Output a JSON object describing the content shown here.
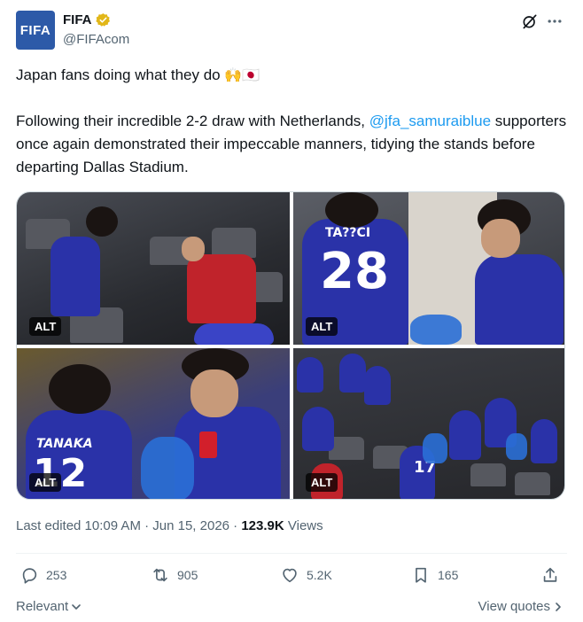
{
  "author": {
    "avatar_text": "FIFA",
    "display_name": "FIFA",
    "handle": "@FIFAcom",
    "verified_color": "#e2b719",
    "avatar_color": "#2d5aa8"
  },
  "post": {
    "line1_text": "Japan fans doing what they do",
    "line1_emoji": "🙌🇯🇵",
    "para_before": "Following their incredible 2-2 draw with Netherlands, ",
    "mention": "@jfa_samuraiblue",
    "para_after": " supporters once again demonstrated their impeccable manners, tidying the stands before departing Dallas Stadium.",
    "mention_color": "#1d9bf0"
  },
  "media": {
    "alt_label": "ALT",
    "photos": [
      {
        "jersey_number": "",
        "name_text": ""
      },
      {
        "jersey_number": "28",
        "name_text": "TA??CI"
      },
      {
        "jersey_number": "12",
        "name_text": "TANAKA"
      },
      {
        "jersey_number": "17",
        "name_text": ""
      }
    ]
  },
  "meta": {
    "edited": "Last edited 10:09 AM · Jun 15, 2026 · ",
    "views_count": "123.9K",
    "views_label": " Views"
  },
  "actions": {
    "replies": "253",
    "reposts": "905",
    "likes": "5.2K",
    "bookmarks": "165"
  },
  "footer": {
    "sort_label": "Relevant",
    "view_quotes": "View quotes"
  },
  "icons": [
    "verified-badge-icon",
    "grok-icon",
    "more-icon",
    "reply-icon",
    "repost-icon",
    "like-icon",
    "bookmark-icon",
    "share-icon",
    "chevron-down-icon",
    "chevron-right-icon"
  ]
}
